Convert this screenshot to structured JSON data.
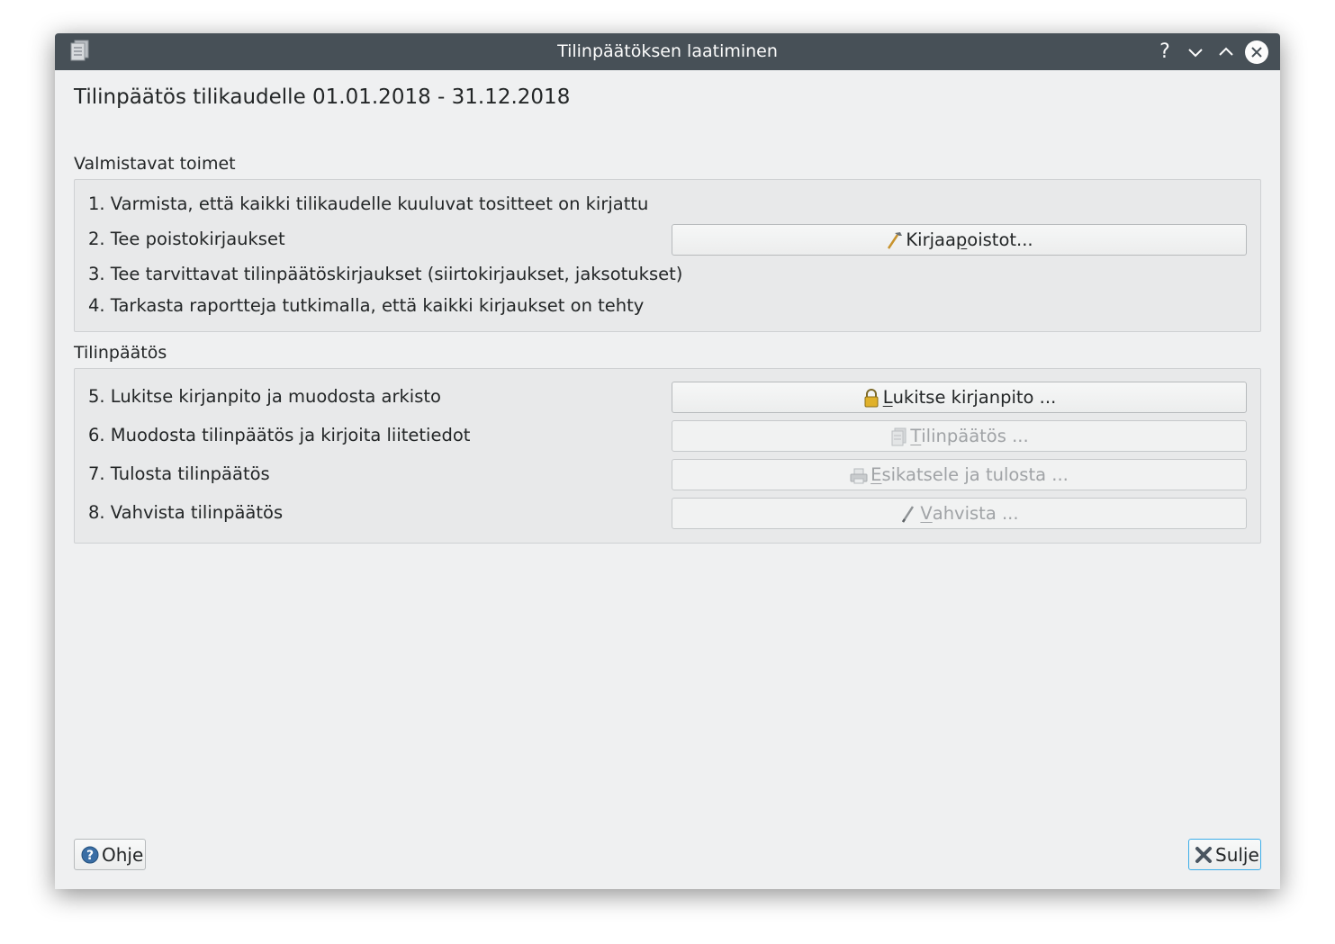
{
  "window": {
    "title": "Tilinpäätöksen laatiminen",
    "help_glyph": "?"
  },
  "heading": "Tilinpäätös tilikaudelle 01.01.2018 - 31.12.2018",
  "preparation": {
    "label": "Valmistavat toimet",
    "steps": [
      "1. Varmista, että kaikki tilikaudelle kuuluvat tositteet on kirjattu",
      "2. Tee poistokirjaukset",
      "3. Tee tarvittavat tilinpäätöskirjaukset (siirtokirjaukset, jaksotukset)",
      "4. Tarkasta raportteja tutkimalla, että kaikki kirjaukset on tehty"
    ],
    "depreciation_button": {
      "pre": "Kirjaa ",
      "mnemonic": "p",
      "post": "oistot...",
      "icon": "hammer-icon"
    }
  },
  "closing": {
    "label": "Tilinpäätös",
    "steps": [
      "5. Lukitse kirjanpito ja muodosta arkisto",
      "6. Muodosta tilinpäätös ja kirjoita liitetiedot",
      "7. Tulosta tilinpäätös",
      "8. Vahvista tilinpäätös"
    ],
    "buttons": [
      {
        "mnemonic": "L",
        "rest": "ukitse kirjanpito ...",
        "icon": "lock-icon",
        "enabled": true
      },
      {
        "mnemonic": "T",
        "rest": "ilinpäätös ...",
        "icon": "document-icon",
        "enabled": false
      },
      {
        "mnemonic": "E",
        "rest": "sikatsele ja tulosta ...",
        "icon": "printer-icon",
        "enabled": false
      },
      {
        "mnemonic": "V",
        "rest": "ahvista ...",
        "icon": "pen-icon",
        "enabled": false
      }
    ]
  },
  "footer": {
    "help_label": "Ohje",
    "close_label": "Sulje"
  },
  "colors": {
    "titlebar": "#475057",
    "window_bg": "#eff0f1",
    "focus_accent": "#3daee9",
    "text": "#232627",
    "disabled_text": "#a0a3a6"
  }
}
